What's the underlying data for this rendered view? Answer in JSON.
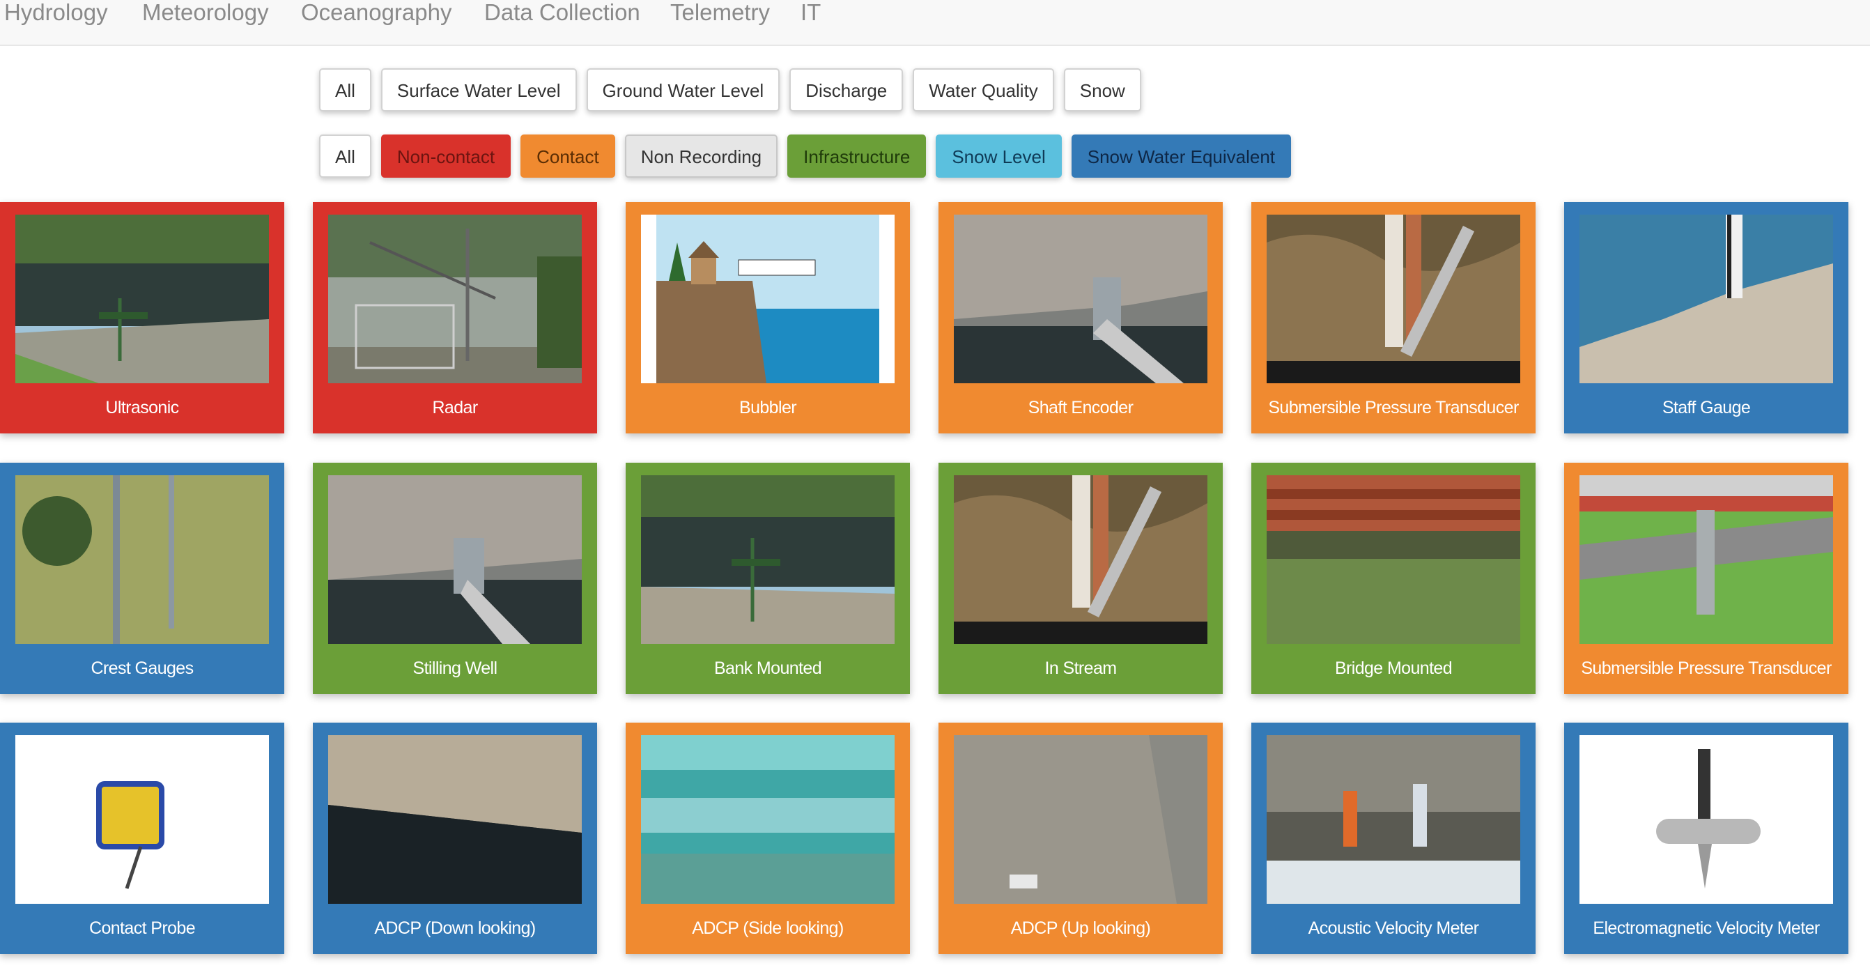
{
  "nav": {
    "items": [
      "Hydrology",
      "Meteorology",
      "Oceanography",
      "Data Collection",
      "Telemetry",
      "IT"
    ]
  },
  "filters": {
    "measure": [
      "All",
      "Surface Water Level",
      "Ground Water Level",
      "Discharge",
      "Water Quality",
      "Snow"
    ],
    "type": [
      "All",
      "Non-contact",
      "Contact",
      "Non Recording",
      "Infrastructure",
      "Snow Level",
      "Snow Water Equivalent"
    ]
  },
  "colors": {
    "non_contact": "#d9322b",
    "contact": "#f08a30",
    "infrastructure": "#6b9f38",
    "snow_level": "#5bc0de",
    "snow_water_equivalent": "#347ab7",
    "blue_tile": "#347ab7"
  },
  "tiles": [
    {
      "label": "Ultrasonic",
      "category": "non-contact",
      "icon": "ultrasonic-photo"
    },
    {
      "label": "Radar",
      "category": "non-contact",
      "icon": "radar-photo"
    },
    {
      "label": "Bubbler",
      "category": "contact",
      "icon": "bubbler-diagram"
    },
    {
      "label": "Shaft Encoder",
      "category": "contact",
      "icon": "shaft-encoder-photo"
    },
    {
      "label": "Submersible Pressure Transducer",
      "category": "contact",
      "icon": "pressure-transducer-photo"
    },
    {
      "label": "Staff Gauge",
      "category": "non-recording",
      "icon": "staff-gauge-photo"
    },
    {
      "label": "Crest Gauges",
      "category": "non-recording",
      "icon": "crest-gauge-photo"
    },
    {
      "label": "Stilling Well",
      "category": "infrastructure",
      "icon": "stilling-well-photo"
    },
    {
      "label": "Bank Mounted",
      "category": "infrastructure",
      "icon": "bank-mounted-photo"
    },
    {
      "label": "In Stream",
      "category": "infrastructure",
      "icon": "in-stream-photo"
    },
    {
      "label": "Bridge Mounted",
      "category": "infrastructure",
      "icon": "bridge-mounted-photo"
    },
    {
      "label": "Submersible Pressure Transducer",
      "category": "contact",
      "icon": "pressure-transducer-photo"
    },
    {
      "label": "Contact Probe",
      "category": "non-recording",
      "icon": "contact-probe-photo"
    },
    {
      "label": "ADCP (Down looking)",
      "category": "non-recording",
      "icon": "adcp-down-photo"
    },
    {
      "label": "ADCP (Side looking)",
      "category": "contact",
      "icon": "adcp-side-illustration"
    },
    {
      "label": "ADCP (Up looking)",
      "category": "contact",
      "icon": "adcp-up-photo"
    },
    {
      "label": "Acoustic Velocity Meter",
      "category": "non-recording",
      "icon": "acoustic-velocity-photo"
    },
    {
      "label": "Electromagnetic Velocity Meter",
      "category": "non-recording",
      "icon": "em-velocity-photo"
    }
  ]
}
